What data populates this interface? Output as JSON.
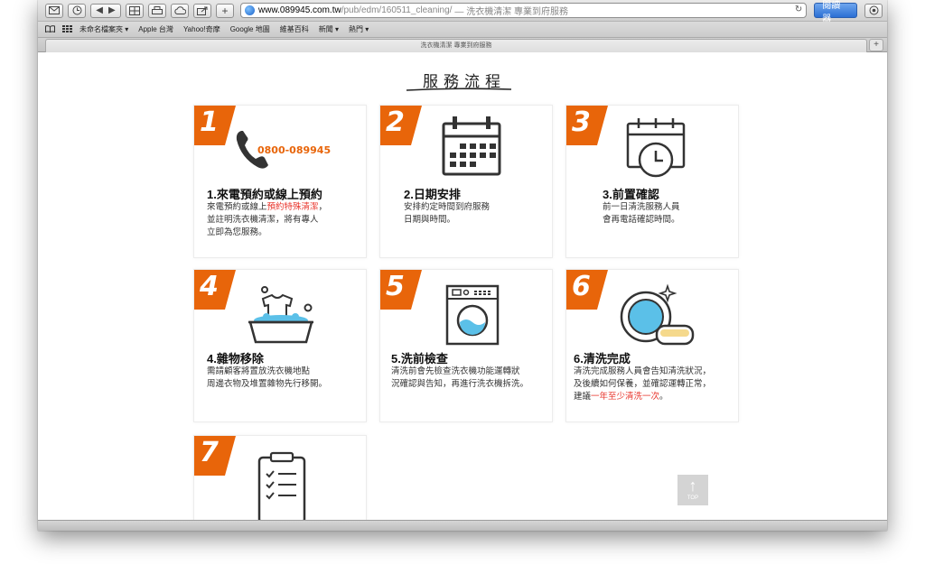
{
  "browser": {
    "url_host": "www.089945.com.tw",
    "url_path": "/pub/edm/160511_cleaning/",
    "url_page_title": "— 洗衣機清潔 專業到府服務",
    "reader_label": "閱讀器",
    "tab_title": "洗衣機清潔 專業到府服務",
    "tab_add": "+",
    "bookmarks": [
      "未命名檔案夾 ▾",
      "Apple 台灣",
      "Yahoo!奇摩",
      "Google 地圖",
      "維基百科",
      "新聞 ▾",
      "熱門 ▾"
    ]
  },
  "page": {
    "heading": "服務流程",
    "top_label": "TOP",
    "accent_color": "#e8650a",
    "highlight_color": "#e8332a"
  },
  "steps": [
    {
      "num": "1",
      "title": "1.來電預約或線上預約",
      "icon": "phone-icon",
      "phone": "0800-089945",
      "desc_pre": "來電預約或線上",
      "desc_hl": "預約特殊清潔",
      "desc_post": "，",
      "desc2": "並註明洗衣機清潔，將有專人",
      "desc3": "立即為您服務。"
    },
    {
      "num": "2",
      "title": "2.日期安排",
      "icon": "calendar-icon",
      "desc1": "安排約定時間到府服務",
      "desc2": "日期與時間。"
    },
    {
      "num": "3",
      "title": "3.前置確認",
      "icon": "calendar-clock-icon",
      "desc1": "前一日清洗服務人員",
      "desc2": "會再電話確認時間。"
    },
    {
      "num": "4",
      "title": "4.雜物移除",
      "icon": "laundry-basin-icon",
      "desc1": "需請顧客將置放洗衣機地點",
      "desc2": "周邊衣物及堆置雜物先行移開。"
    },
    {
      "num": "5",
      "title": "5.洗前檢查",
      "icon": "washing-machine-icon",
      "desc1": "清洗前會先檢查洗衣機功能運轉狀",
      "desc2": "況確認與告知，再進行洗衣機拆洗。"
    },
    {
      "num": "6",
      "title": "6.清洗完成",
      "icon": "clean-dish-icon",
      "desc1": "清洗完成服務人員會告知清洗狀況，",
      "desc2": "及後續如何保養，並確認運轉正常，",
      "desc3_pre": "建議",
      "desc3_hl": "一年至少清洗一次",
      "desc3_post": "。"
    },
    {
      "num": "7",
      "title": "",
      "icon": "checklist-icon"
    }
  ]
}
